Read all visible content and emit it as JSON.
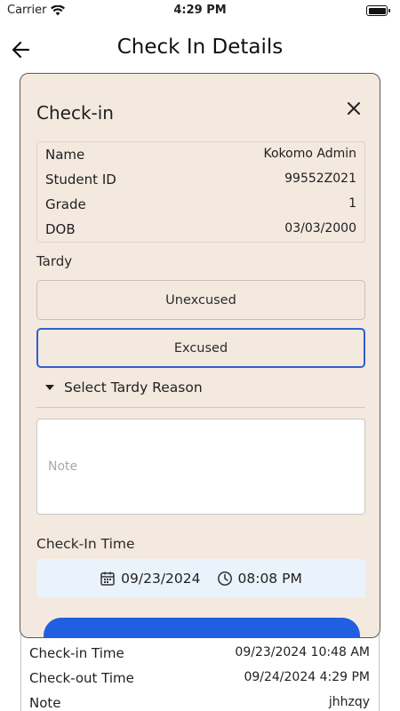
{
  "status_bar": {
    "carrier": "Carrier",
    "time": "4:29 PM"
  },
  "header": {
    "title": "Check In Details"
  },
  "dialog": {
    "title": "Check-in",
    "student_info": [
      {
        "label": "Name",
        "value": "Kokomo Admin"
      },
      {
        "label": "Student ID",
        "value": "99552Z021"
      },
      {
        "label": "Grade",
        "value": "1"
      },
      {
        "label": "DOB",
        "value": "03/03/2000"
      }
    ],
    "tardy_label": "Tardy",
    "tardy_options": [
      {
        "label": "Unexcused",
        "selected": false
      },
      {
        "label": "Excused",
        "selected": true
      }
    ],
    "reason_dropdown": "Select Tardy Reason",
    "note_placeholder": "Note",
    "checkin_time_label": "Check-In Time",
    "checkin_date": "09/23/2024",
    "checkin_time": "08:08 PM"
  },
  "details": [
    {
      "label": "Check-in Time",
      "value": "09/23/2024 10:48 AM"
    },
    {
      "label": "Check-out Time",
      "value": "09/24/2024 4:29 PM"
    },
    {
      "label": "Note",
      "value": "jhhzqy"
    }
  ],
  "colors": {
    "dialog_bg": "#f3e9df",
    "accent": "#2f5fd0",
    "time_bg": "#eaf2fb",
    "button": "#1f5fe0"
  }
}
